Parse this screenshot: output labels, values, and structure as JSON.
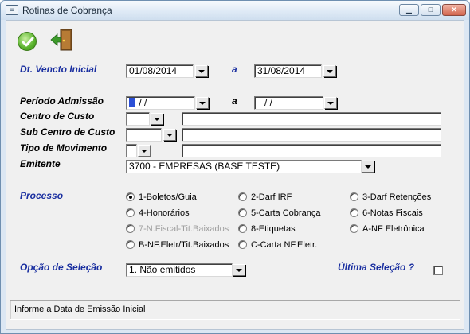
{
  "window": {
    "title": "Rotinas de Cobrança",
    "icon": "app-window-icon",
    "min_glyph": "▁",
    "max_glyph": "□",
    "close_glyph": "✕"
  },
  "toolbar": {
    "confirm_icon": "check-icon",
    "exit_icon": "exit-door-icon"
  },
  "form": {
    "vencto": {
      "label": "Dt. Vencto Inicial",
      "start": "01/08/2014",
      "sep": "a",
      "end": "31/08/2014"
    },
    "admissao": {
      "label": "Período Admissão",
      "start": " /  /",
      "sep": "a",
      "end": " /  /"
    },
    "centro_custo": {
      "label": "Centro de Custo",
      "code": "",
      "desc": ""
    },
    "sub_centro": {
      "label": "Sub Centro de Custo",
      "code": "",
      "desc": ""
    },
    "tipo_mov": {
      "label": "Tipo de Movimento",
      "code": "",
      "desc": ""
    },
    "emitente": {
      "label": "Emitente",
      "value": "3700 - EMPRESAS (BASE TESTE)"
    },
    "processo": {
      "label": "Processo",
      "options": [
        {
          "label": "1-Boletos/Guia",
          "selected": true,
          "enabled": true
        },
        {
          "label": "2-Darf IRF",
          "selected": false,
          "enabled": true
        },
        {
          "label": "3-Darf Retenções",
          "selected": false,
          "enabled": true
        },
        {
          "label": "4-Honorários",
          "selected": false,
          "enabled": true
        },
        {
          "label": "5-Carta Cobrança",
          "selected": false,
          "enabled": true
        },
        {
          "label": "6-Notas Fiscais",
          "selected": false,
          "enabled": true
        },
        {
          "label": "7-N.Fiscal-Tit.Baixados",
          "selected": false,
          "enabled": false
        },
        {
          "label": "8-Etiquetas",
          "selected": false,
          "enabled": true
        },
        {
          "label": "A-NF Eletrônica",
          "selected": false,
          "enabled": true
        },
        {
          "label": "B-NF.Eletr/Tit.Baixados",
          "selected": false,
          "enabled": true
        },
        {
          "label": "C-Carta NF.Eletr.",
          "selected": false,
          "enabled": true
        }
      ]
    },
    "opcao": {
      "label": "Opção de Seleção",
      "value": "1. Não emitidos"
    },
    "ultima": {
      "label": "Última Seleção  ?",
      "checked": false
    }
  },
  "status": {
    "text": "Informe a Data de Emissão Inicial"
  },
  "colors": {
    "label_blue": "#1a2fa0",
    "caret_blue": "#2b4fd6",
    "title_bar": "#dfeaf6"
  }
}
